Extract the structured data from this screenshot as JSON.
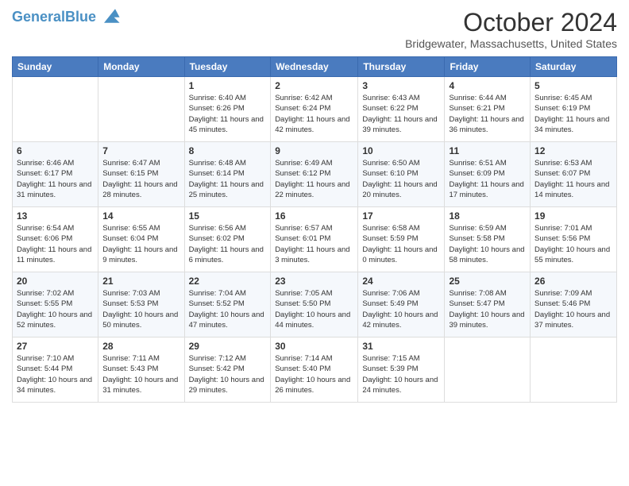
{
  "header": {
    "logo_line1": "General",
    "logo_line2": "Blue",
    "month": "October 2024",
    "location": "Bridgewater, Massachusetts, United States"
  },
  "weekdays": [
    "Sunday",
    "Monday",
    "Tuesday",
    "Wednesday",
    "Thursday",
    "Friday",
    "Saturday"
  ],
  "weeks": [
    [
      {
        "day": "",
        "info": ""
      },
      {
        "day": "",
        "info": ""
      },
      {
        "day": "1",
        "info": "Sunrise: 6:40 AM\nSunset: 6:26 PM\nDaylight: 11 hours and 45 minutes."
      },
      {
        "day": "2",
        "info": "Sunrise: 6:42 AM\nSunset: 6:24 PM\nDaylight: 11 hours and 42 minutes."
      },
      {
        "day": "3",
        "info": "Sunrise: 6:43 AM\nSunset: 6:22 PM\nDaylight: 11 hours and 39 minutes."
      },
      {
        "day": "4",
        "info": "Sunrise: 6:44 AM\nSunset: 6:21 PM\nDaylight: 11 hours and 36 minutes."
      },
      {
        "day": "5",
        "info": "Sunrise: 6:45 AM\nSunset: 6:19 PM\nDaylight: 11 hours and 34 minutes."
      }
    ],
    [
      {
        "day": "6",
        "info": "Sunrise: 6:46 AM\nSunset: 6:17 PM\nDaylight: 11 hours and 31 minutes."
      },
      {
        "day": "7",
        "info": "Sunrise: 6:47 AM\nSunset: 6:15 PM\nDaylight: 11 hours and 28 minutes."
      },
      {
        "day": "8",
        "info": "Sunrise: 6:48 AM\nSunset: 6:14 PM\nDaylight: 11 hours and 25 minutes."
      },
      {
        "day": "9",
        "info": "Sunrise: 6:49 AM\nSunset: 6:12 PM\nDaylight: 11 hours and 22 minutes."
      },
      {
        "day": "10",
        "info": "Sunrise: 6:50 AM\nSunset: 6:10 PM\nDaylight: 11 hours and 20 minutes."
      },
      {
        "day": "11",
        "info": "Sunrise: 6:51 AM\nSunset: 6:09 PM\nDaylight: 11 hours and 17 minutes."
      },
      {
        "day": "12",
        "info": "Sunrise: 6:53 AM\nSunset: 6:07 PM\nDaylight: 11 hours and 14 minutes."
      }
    ],
    [
      {
        "day": "13",
        "info": "Sunrise: 6:54 AM\nSunset: 6:06 PM\nDaylight: 11 hours and 11 minutes."
      },
      {
        "day": "14",
        "info": "Sunrise: 6:55 AM\nSunset: 6:04 PM\nDaylight: 11 hours and 9 minutes."
      },
      {
        "day": "15",
        "info": "Sunrise: 6:56 AM\nSunset: 6:02 PM\nDaylight: 11 hours and 6 minutes."
      },
      {
        "day": "16",
        "info": "Sunrise: 6:57 AM\nSunset: 6:01 PM\nDaylight: 11 hours and 3 minutes."
      },
      {
        "day": "17",
        "info": "Sunrise: 6:58 AM\nSunset: 5:59 PM\nDaylight: 11 hours and 0 minutes."
      },
      {
        "day": "18",
        "info": "Sunrise: 6:59 AM\nSunset: 5:58 PM\nDaylight: 10 hours and 58 minutes."
      },
      {
        "day": "19",
        "info": "Sunrise: 7:01 AM\nSunset: 5:56 PM\nDaylight: 10 hours and 55 minutes."
      }
    ],
    [
      {
        "day": "20",
        "info": "Sunrise: 7:02 AM\nSunset: 5:55 PM\nDaylight: 10 hours and 52 minutes."
      },
      {
        "day": "21",
        "info": "Sunrise: 7:03 AM\nSunset: 5:53 PM\nDaylight: 10 hours and 50 minutes."
      },
      {
        "day": "22",
        "info": "Sunrise: 7:04 AM\nSunset: 5:52 PM\nDaylight: 10 hours and 47 minutes."
      },
      {
        "day": "23",
        "info": "Sunrise: 7:05 AM\nSunset: 5:50 PM\nDaylight: 10 hours and 44 minutes."
      },
      {
        "day": "24",
        "info": "Sunrise: 7:06 AM\nSunset: 5:49 PM\nDaylight: 10 hours and 42 minutes."
      },
      {
        "day": "25",
        "info": "Sunrise: 7:08 AM\nSunset: 5:47 PM\nDaylight: 10 hours and 39 minutes."
      },
      {
        "day": "26",
        "info": "Sunrise: 7:09 AM\nSunset: 5:46 PM\nDaylight: 10 hours and 37 minutes."
      }
    ],
    [
      {
        "day": "27",
        "info": "Sunrise: 7:10 AM\nSunset: 5:44 PM\nDaylight: 10 hours and 34 minutes."
      },
      {
        "day": "28",
        "info": "Sunrise: 7:11 AM\nSunset: 5:43 PM\nDaylight: 10 hours and 31 minutes."
      },
      {
        "day": "29",
        "info": "Sunrise: 7:12 AM\nSunset: 5:42 PM\nDaylight: 10 hours and 29 minutes."
      },
      {
        "day": "30",
        "info": "Sunrise: 7:14 AM\nSunset: 5:40 PM\nDaylight: 10 hours and 26 minutes."
      },
      {
        "day": "31",
        "info": "Sunrise: 7:15 AM\nSunset: 5:39 PM\nDaylight: 10 hours and 24 minutes."
      },
      {
        "day": "",
        "info": ""
      },
      {
        "day": "",
        "info": ""
      }
    ]
  ]
}
